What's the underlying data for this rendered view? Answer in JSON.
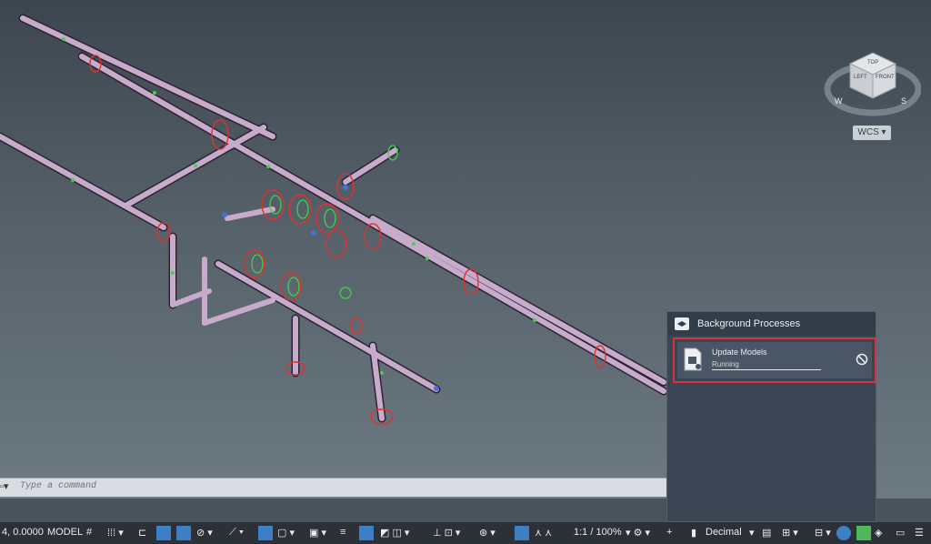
{
  "viewcube": {
    "top": "TOP",
    "left": "LEFT",
    "front": "FRONT",
    "west": "W",
    "south": "S"
  },
  "wcs_label": "WCS",
  "command_line": {
    "placeholder": "Type a command"
  },
  "background_processes": {
    "title": "Background Processes",
    "process": {
      "name": "Update Models",
      "status": "Running",
      "progress": 1.0
    }
  },
  "status_bar": {
    "coords": "4, 0.0000",
    "model": "MODEL",
    "scale": "1:1 / 100%",
    "units": "Decimal"
  },
  "colors": {
    "pipe": "#c8aacd",
    "accent": "#4fa3e0",
    "highlight": "#d3343e"
  }
}
